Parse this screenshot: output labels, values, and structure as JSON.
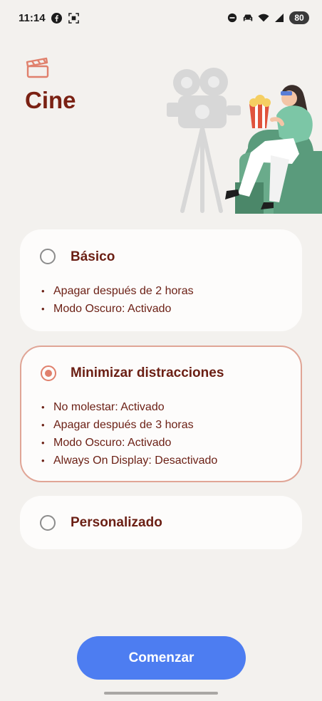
{
  "status_bar": {
    "time": "11:14",
    "battery": "80",
    "icons": [
      "facebook-icon",
      "screenshot-icon",
      "dnd-icon",
      "car-icon",
      "wifi-icon",
      "signal-icon"
    ]
  },
  "header": {
    "title": "Cine",
    "icon": "clapperboard-icon"
  },
  "options": [
    {
      "label": "Básico",
      "selected": false,
      "items": [
        "Apagar después de 2 horas",
        "Modo Oscuro: Activado"
      ]
    },
    {
      "label": "Minimizar distracciones",
      "selected": true,
      "items": [
        "No molestar: Activado",
        "Apagar después de 3 horas",
        "Modo Oscuro: Activado",
        "Always On Display: Desactivado"
      ]
    },
    {
      "label": "Personalizado",
      "selected": false,
      "items": []
    }
  ],
  "start_button": {
    "label": "Comenzar"
  },
  "colors": {
    "accent": "#e0806c",
    "title": "#7a2113",
    "button": "#4d7df1",
    "background": "#f3f1ee"
  }
}
